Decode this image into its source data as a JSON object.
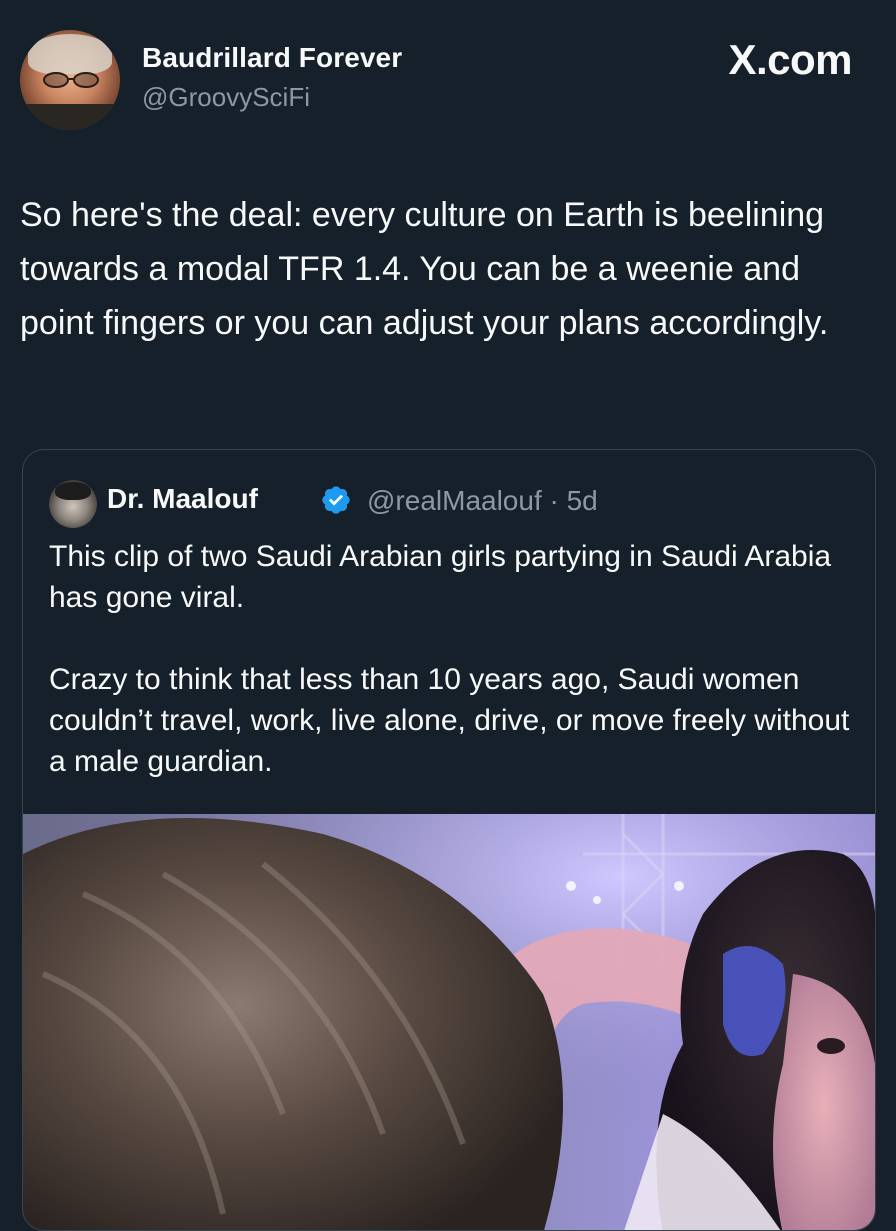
{
  "tweet": {
    "author_name": "Baudrillard Forever",
    "author_handle": "@GroovySciFi",
    "brand": "X.com",
    "text": "So here's the deal: every culture on Earth is beelining towards a modal TFR 1.4. You can be a weenie and point fingers or you can adjust your plans accordingly."
  },
  "quoted_tweet": {
    "author_name": "Dr. Maalouf",
    "verified": true,
    "handle_time": "@realMaalouf · 5d",
    "paragraphs": [
      "This clip of two Saudi Arabian girls partying in Saudi Arabia has gone viral.",
      "Crazy to think that less than 10 years ago, Saudi women couldn’t travel, work, live alone, drive, or move freely without a male guardian."
    ],
    "media": {
      "kind": "video-still"
    }
  },
  "colors": {
    "background": "#15202b",
    "text_primary": "#f7f9f9",
    "text_secondary": "#8b98a5",
    "border": "#38444d",
    "verified_badge": "#1d9bf0"
  },
  "icons": [
    "avatar-image",
    "verified-badge-icon"
  ]
}
